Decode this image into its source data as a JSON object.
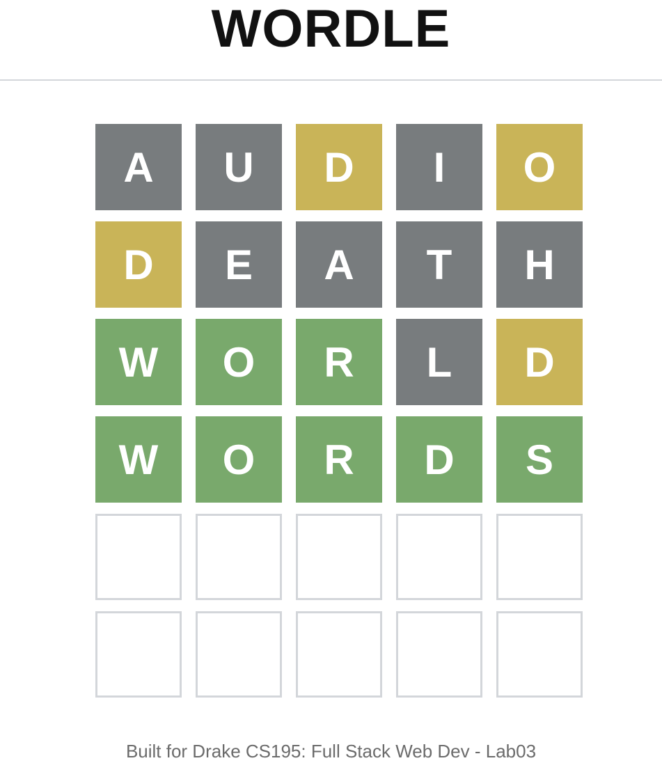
{
  "header": {
    "title": "WORDLE"
  },
  "colors": {
    "absent": "#787c7e",
    "present": "#c9b458",
    "correct": "#79a96c",
    "empty_border": "#d3d6da"
  },
  "board": {
    "rows": [
      [
        {
          "letter": "A",
          "state": "absent"
        },
        {
          "letter": "U",
          "state": "absent"
        },
        {
          "letter": "D",
          "state": "present"
        },
        {
          "letter": "I",
          "state": "absent"
        },
        {
          "letter": "O",
          "state": "present"
        }
      ],
      [
        {
          "letter": "D",
          "state": "present"
        },
        {
          "letter": "E",
          "state": "absent"
        },
        {
          "letter": "A",
          "state": "absent"
        },
        {
          "letter": "T",
          "state": "absent"
        },
        {
          "letter": "H",
          "state": "absent"
        }
      ],
      [
        {
          "letter": "W",
          "state": "correct"
        },
        {
          "letter": "O",
          "state": "correct"
        },
        {
          "letter": "R",
          "state": "correct"
        },
        {
          "letter": "L",
          "state": "absent"
        },
        {
          "letter": "D",
          "state": "present"
        }
      ],
      [
        {
          "letter": "W",
          "state": "correct"
        },
        {
          "letter": "O",
          "state": "correct"
        },
        {
          "letter": "R",
          "state": "correct"
        },
        {
          "letter": "D",
          "state": "correct"
        },
        {
          "letter": "S",
          "state": "correct"
        }
      ],
      [
        {
          "letter": "",
          "state": "empty"
        },
        {
          "letter": "",
          "state": "empty"
        },
        {
          "letter": "",
          "state": "empty"
        },
        {
          "letter": "",
          "state": "empty"
        },
        {
          "letter": "",
          "state": "empty"
        }
      ],
      [
        {
          "letter": "",
          "state": "empty"
        },
        {
          "letter": "",
          "state": "empty"
        },
        {
          "letter": "",
          "state": "empty"
        },
        {
          "letter": "",
          "state": "empty"
        },
        {
          "letter": "",
          "state": "empty"
        }
      ]
    ]
  },
  "footer": {
    "text": "Built for Drake CS195: Full Stack Web Dev - Lab03"
  }
}
